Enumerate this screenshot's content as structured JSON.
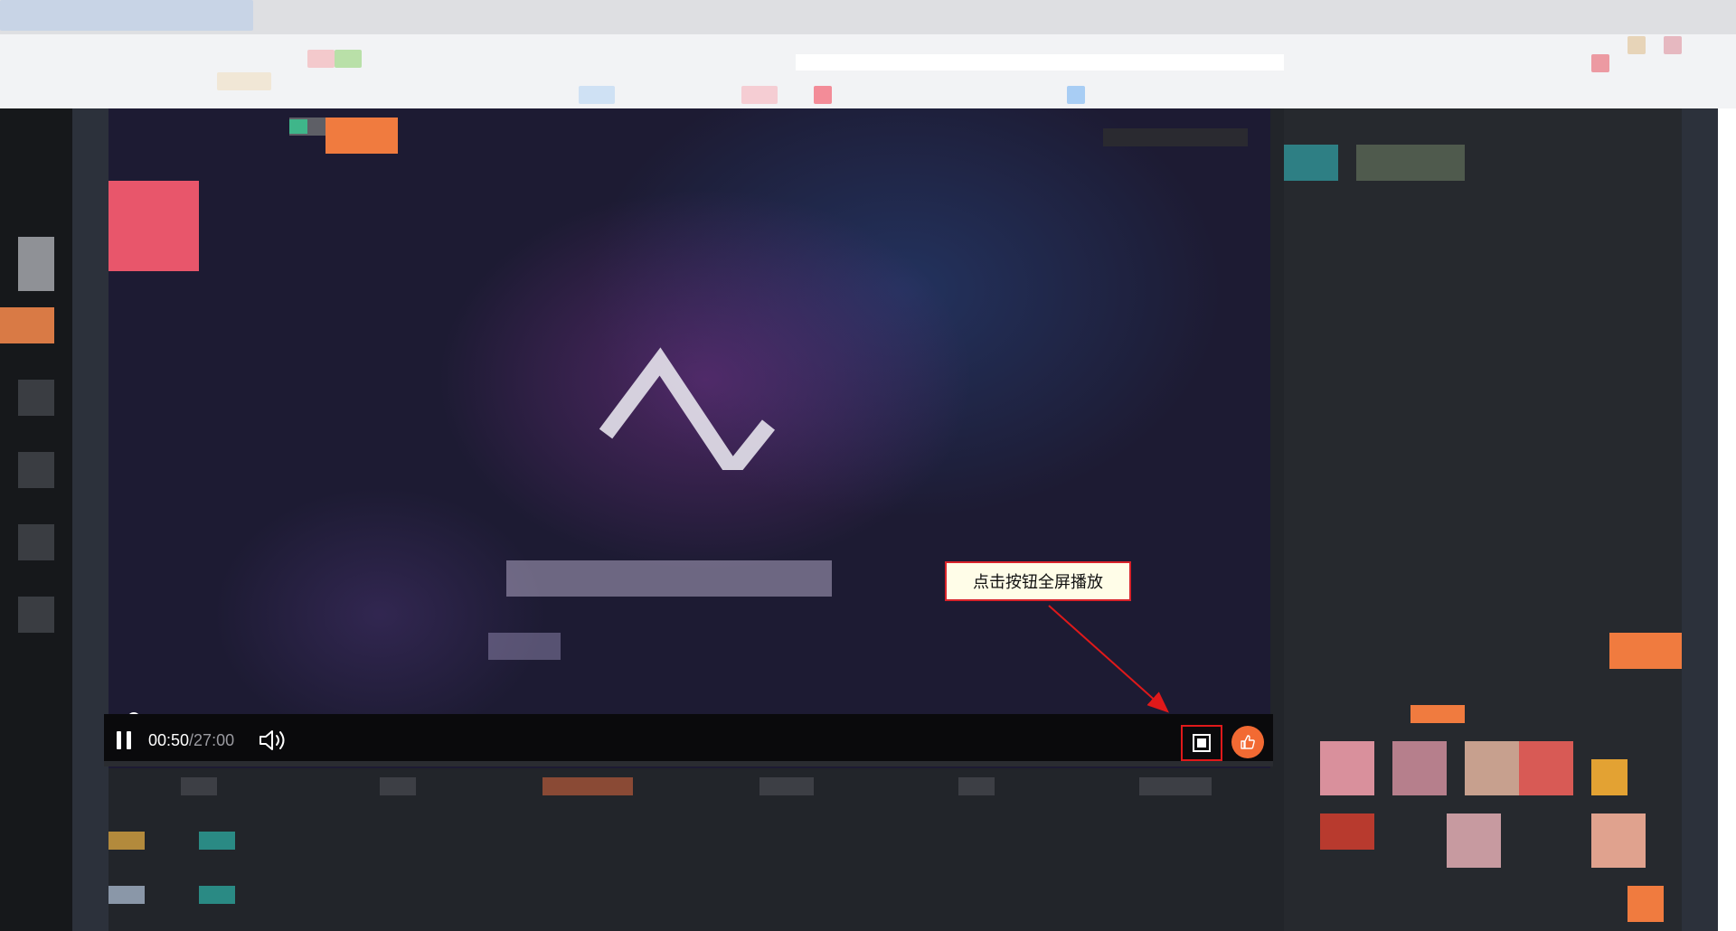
{
  "player": {
    "current_time": "00:50",
    "duration": "/27:00",
    "progress": 0.0258,
    "pause_icon": "pause-icon",
    "volume_icon": "volume-icon",
    "fullscreen_icon": "fullscreen-icon",
    "like_icon": "thumbs-up-icon"
  },
  "annotation": {
    "tooltip_text": "点击按钮全屏播放",
    "arrow_color": "#e0191a"
  },
  "colors": {
    "accent": "#f26a33",
    "highlight": "#e0191a"
  }
}
